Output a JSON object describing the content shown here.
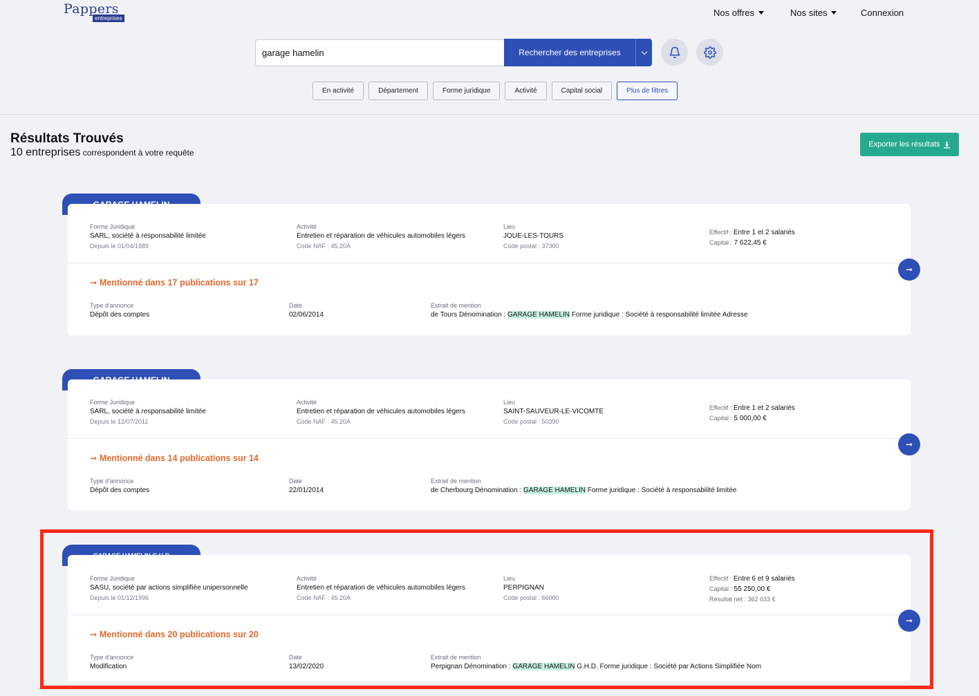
{
  "header": {
    "logo_main": "Pappers",
    "logo_sub": "entreprises",
    "nav": {
      "offers": "Nos offres",
      "sites": "Nos sites",
      "login": "Connexion"
    }
  },
  "search": {
    "value": "garage hamelin",
    "button_label": "Rechercher des entreprises",
    "icons": {
      "dropdown": "chevron-down-icon",
      "alerts": "bell-icon",
      "settings": "gear-icon"
    }
  },
  "filters": [
    "En activité",
    "Département",
    "Forme juridique",
    "Activité",
    "Capital social",
    "Plus de filtres"
  ],
  "results": {
    "title": "Résultats Trouvés",
    "count_label": "10 entreprises",
    "count_suffix": " correspondent à votre requête",
    "export_label": "Exporter les résultats"
  },
  "labels": {
    "forme": "Forme Juridique",
    "activite": "Activité",
    "lieu": "Lieu",
    "effectif": "Effectif : ",
    "capital": "Capital : ",
    "resultat": "Résultat net : ",
    "type": "Type d'annonce",
    "date": "Date",
    "extrait": "Extrait de mention"
  },
  "companies": [
    {
      "name": "GARAGE HAMELIN",
      "forme": "SARL, société à responsabilité limitée",
      "depuis": "Depuis le 01/04/1989",
      "activite": "Entretien et réparation de véhicules automobiles légers",
      "naf": "Code NAF : 45.20A",
      "lieu": "JOUE-LES-TOURS",
      "cp": "Code postal : 37300",
      "effectif": "Entre 1 et 2 salariés",
      "capital": "7 622,45 €",
      "mention": "➞ Mentionné dans 17 publications sur 17",
      "type": "Dépôt des comptes",
      "date": "02/06/2014",
      "extrait_pre": "de Tours Dénomination : ",
      "extrait_hl": "GARAGE HAMELIN",
      "extrait_post": " Forme juridique : Société à responsabilité limitée Adresse"
    },
    {
      "name": "GARAGE HAMELIN",
      "forme": "SARL, société à responsabilité limitée",
      "depuis": "Depuis le 12/07/2011",
      "activite": "Entretien et réparation de véhicules automobiles légers",
      "naf": "Code NAF : 45.20A",
      "lieu": "SAINT-SAUVEUR-LE-VICOMTE",
      "cp": "Code postal : 50390",
      "effectif": "Entre 1 et 2 salariés",
      "capital": "5 000,00 €",
      "mention": "➞ Mentionné dans 14 publications sur 14",
      "type": "Dépôt des comptes",
      "date": "22/01/2014",
      "extrait_pre": "de Cherbourg Dénomination : ",
      "extrait_hl": "GARAGE HAMELIN",
      "extrait_post": " Forme juridique : Société à responsabilité limitée"
    },
    {
      "name": "GARAGE HAMELIN G.H.D",
      "forme": "SASU, société par actions simplifiée unipersonnelle",
      "depuis": "Depuis le 01/12/1996",
      "activite": "Entretien et réparation de véhicules automobiles légers",
      "naf": "Code NAF : 45.20A",
      "lieu": "PERPIGNAN",
      "cp": "Code postal : 66000",
      "effectif": "Entre 6 et 9 salariés",
      "capital": "55 250,00 €",
      "resultat": "362 033 €",
      "mention": "➞ Mentionné dans 20 publications sur 20",
      "type": "Modification",
      "date": "13/02/2020",
      "extrait_pre": "Perpignan Dénomination : ",
      "extrait_hl": "GARAGE HAMELIN",
      "extrait_post": " G.H.D. Forme juridique : Société par Actions Simplifiée Nom"
    }
  ],
  "annotation": {
    "color": "#ff2a17"
  }
}
